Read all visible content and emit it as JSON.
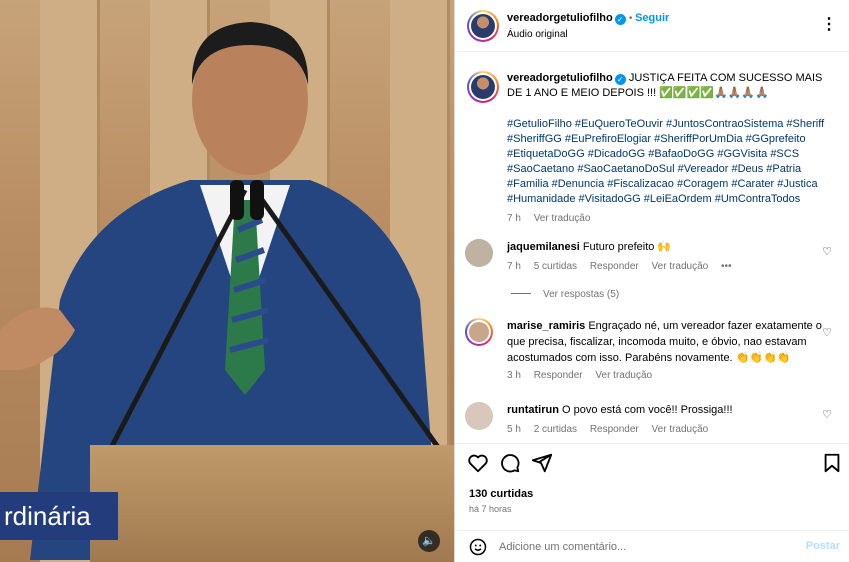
{
  "media": {
    "overlay_text": "rdinária",
    "mute_icon": "speaker-icon"
  },
  "header": {
    "username": "vereadorgetuliofilho",
    "follow_label": "Seguir",
    "subtitle": "Áudio original"
  },
  "post": {
    "username": "vereadorgetuliofilho",
    "caption_text": "JUSTIÇA FEITA COM SUCESSO MAIS DE 1 ANO E MEIO DEPOIS !!! ✅✅✅✅🙏🏽🙏🏽🙏🏽🙏🏽",
    "hashtags": "#GetulioFilho #EuQueroTeOuvir #JuntosContraoSistema #Sheriff #SheriffGG #EuPrefiroElogiar #SheriffPorUmDia #GGprefeito #EtiquetaDoGG #DicadoGG #BafaoDoGG #GGVisita #SCS #SaoCaetano #SaoCaetanoDoSul #Vereador #Deus #Patria #Familia #Denuncia #Fiscalizacao #Coragem #Carater #Justica #Humanidade #VisitadoGG #LeiEaOrdem #UmContraTodos",
    "time": "7 h",
    "translate": "Ver tradução"
  },
  "comments": [
    {
      "username": "jaquemilanesi",
      "text": "Futuro prefeito 🙌",
      "time": "7 h",
      "likes": "5 curtidas",
      "reply": "Responder",
      "translate": "Ver tradução",
      "replies": "Ver respostas (5)"
    },
    {
      "username": "marise_ramiris",
      "text": "Engraçado né, um vereador fazer exatamente o que precisa, fiscalizar, incomoda muito, e óbvio, nao estavam acostumados com isso. Parabéns novamente. 👏👏👏👏",
      "time": "3 h",
      "reply": "Responder",
      "translate": "Ver tradução"
    },
    {
      "username": "runtatirun",
      "text": "O povo está com você!! Prossiga!!!",
      "time": "5 h",
      "likes": "2 curtidas",
      "reply": "Responder",
      "translate": "Ver tradução"
    }
  ],
  "actions": {
    "likes": "130 curtidas",
    "time": "há 7 horas"
  },
  "add_comment": {
    "placeholder": "Adicione um comentário...",
    "post_label": "Postar"
  }
}
